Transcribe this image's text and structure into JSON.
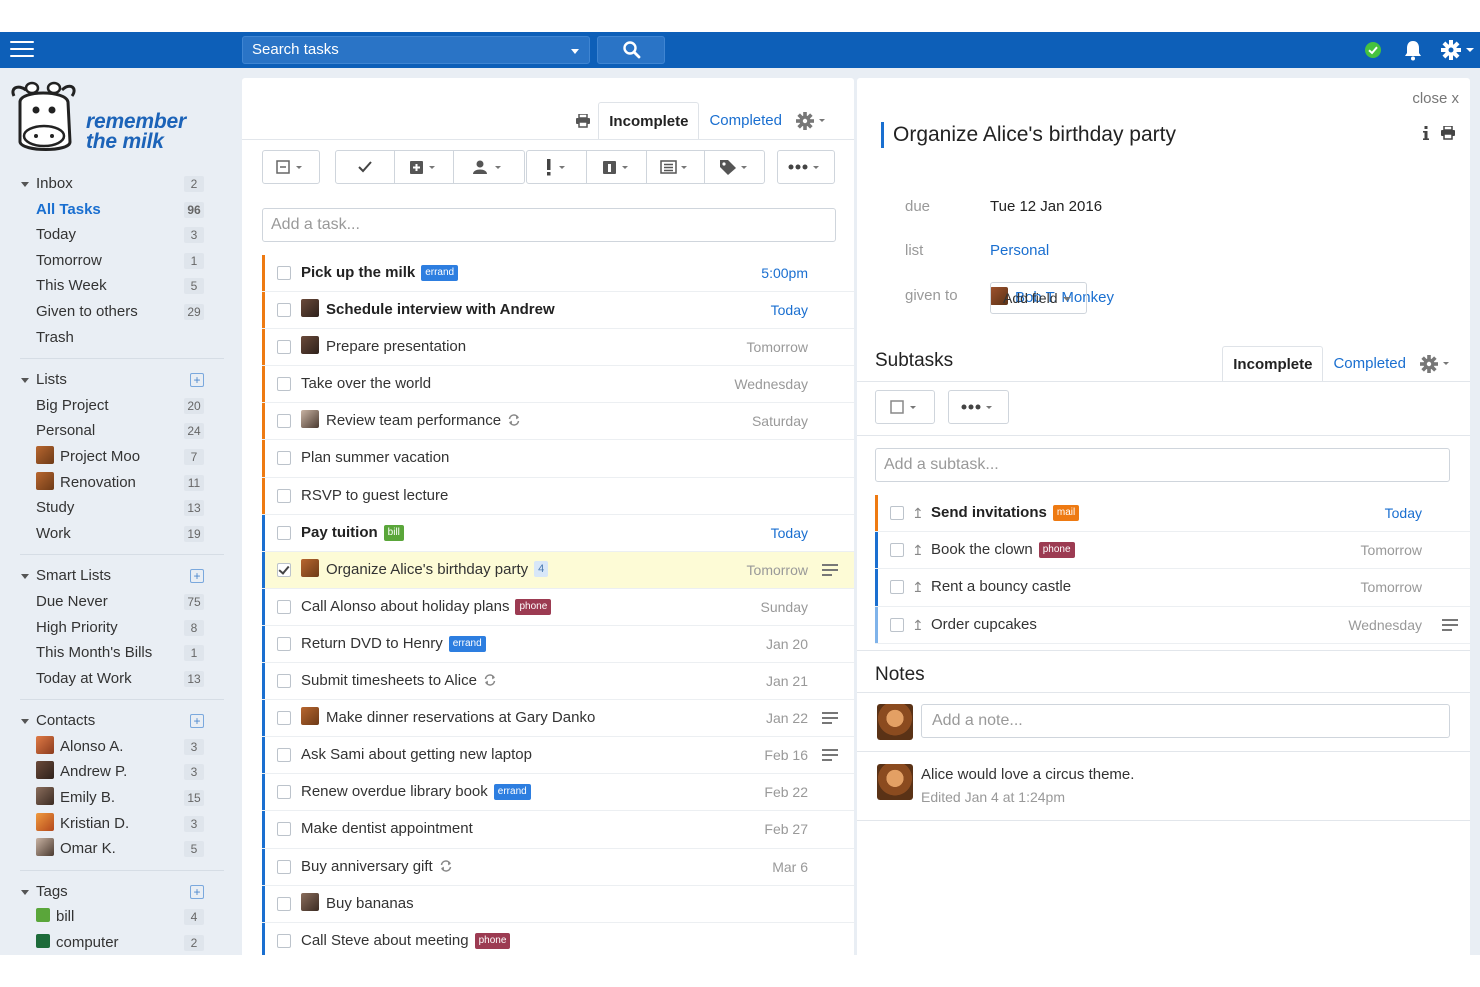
{
  "topbar": {
    "search_placeholder": "Search tasks",
    "accent": "#0d5fb8"
  },
  "logo": {
    "line1": "remember",
    "line2": "the milk"
  },
  "sidebar": {
    "groups": [
      {
        "label": "Inbox",
        "count": "2",
        "items": [
          {
            "label": "All Tasks",
            "count": "96",
            "active": true
          },
          {
            "label": "Today",
            "count": "3"
          },
          {
            "label": "Tomorrow",
            "count": "1"
          },
          {
            "label": "This Week",
            "count": "5"
          },
          {
            "label": "Given to others",
            "count": "29"
          },
          {
            "label": "Trash",
            "count": ""
          }
        ]
      },
      {
        "label": "Lists",
        "items": [
          {
            "label": "Big Project",
            "count": "20"
          },
          {
            "label": "Personal",
            "count": "24"
          },
          {
            "label": "Project Moo",
            "count": "7",
            "avatar": "moo"
          },
          {
            "label": "Renovation",
            "count": "11",
            "avatar": "moo"
          },
          {
            "label": "Study",
            "count": "13"
          },
          {
            "label": "Work",
            "count": "19"
          }
        ]
      },
      {
        "label": "Smart Lists",
        "items": [
          {
            "label": "Due Never",
            "count": "75"
          },
          {
            "label": "High Priority",
            "count": "8"
          },
          {
            "label": "This Month's Bills",
            "count": "1"
          },
          {
            "label": "Today at Work",
            "count": "13"
          }
        ]
      },
      {
        "label": "Contacts",
        "items": [
          {
            "label": "Alonso A.",
            "count": "3",
            "avatar": "alonso"
          },
          {
            "label": "Andrew P.",
            "count": "3",
            "avatar": "andrew"
          },
          {
            "label": "Emily B.",
            "count": "15",
            "avatar": "emily"
          },
          {
            "label": "Kristian D.",
            "count": "3",
            "avatar": "kristian"
          },
          {
            "label": "Omar K.",
            "count": "5",
            "avatar": "omar"
          }
        ]
      },
      {
        "label": "Tags",
        "items": [
          {
            "label": "bill",
            "count": "4",
            "tag": "#5aa63a"
          },
          {
            "label": "computer",
            "count": "2",
            "tag": "#1d6b3a"
          }
        ]
      }
    ]
  },
  "list": {
    "tabs": {
      "incomplete": "Incomplete",
      "completed": "Completed"
    },
    "add_task_placeholder": "Add a task...",
    "tasks": [
      {
        "name": "Pick up the milk",
        "tag": "errand",
        "due": "5:00pm",
        "due_blue": true,
        "bold": true,
        "bar": "#ee7a12"
      },
      {
        "name": "Schedule interview with Andrew",
        "avatar": "andrew",
        "due": "Today",
        "due_blue": true,
        "bold": true,
        "bar": "#ee7a12"
      },
      {
        "name": "Prepare presentation",
        "avatar": "andrew",
        "due": "Tomorrow",
        "bar": "#ee7a12"
      },
      {
        "name": "Take over the world",
        "due": "Wednesday",
        "bar": "#ee7a12"
      },
      {
        "name": "Review team performance",
        "avatar": "omar",
        "repeat": true,
        "due": "Saturday",
        "bar": "#ee7a12"
      },
      {
        "name": "Plan summer vacation",
        "due": "",
        "bar": "#ee7a12"
      },
      {
        "name": "RSVP to guest lecture",
        "due": "",
        "bar": "#ee7a12"
      },
      {
        "name": "Pay tuition",
        "tag": "bill",
        "due": "Today",
        "due_blue": true,
        "bold": true,
        "bar": "#1a6fd0"
      },
      {
        "name": "Organize Alice's birthday party",
        "avatar": "moo",
        "count": "4",
        "due": "Tomorrow",
        "checked": true,
        "selected": true,
        "note": true,
        "bar": "#1a6fd0"
      },
      {
        "name": "Call Alonso about holiday plans",
        "tag": "phone",
        "due": "Sunday",
        "bar": "#1a6fd0"
      },
      {
        "name": "Return DVD to Henry",
        "tag": "errand",
        "due": "Jan 20",
        "bar": "#1a6fd0"
      },
      {
        "name": "Submit timesheets to Alice",
        "repeat": true,
        "due": "Jan 21",
        "bar": "#1a6fd0"
      },
      {
        "name": "Make dinner reservations at Gary Danko",
        "avatar": "moo",
        "due": "Jan 22",
        "note": true,
        "bar": "#1a6fd0"
      },
      {
        "name": "Ask Sami about getting new laptop",
        "due": "Feb 16",
        "note": true,
        "bar": "#1a6fd0"
      },
      {
        "name": "Renew overdue library book",
        "tag": "errand",
        "due": "Feb 22",
        "bar": "#1a6fd0"
      },
      {
        "name": "Make dentist appointment",
        "due": "Feb 27",
        "bar": "#1a6fd0"
      },
      {
        "name": "Buy anniversary gift",
        "repeat": true,
        "due": "Mar 6",
        "bar": "#1a6fd0"
      },
      {
        "name": "Buy bananas",
        "avatar": "emily",
        "due": "",
        "bar": "#1a6fd0"
      },
      {
        "name": "Call Steve about meeting",
        "tag": "phone",
        "due": "",
        "bar": "#1a6fd0"
      }
    ]
  },
  "details": {
    "close": "close x",
    "title": "Organize Alice's birthday party",
    "due_label": "due",
    "due_value": "Tue 12 Jan 2016",
    "list_label": "list",
    "list_value": "Personal",
    "given_label": "given to",
    "given_value": "Bob T. Monkey",
    "add_field": "Add field",
    "subtasks_title": "Subtasks",
    "sub_tabs": {
      "incomplete": "Incomplete",
      "completed": "Completed"
    },
    "add_subtask_placeholder": "Add a subtask...",
    "subtasks": [
      {
        "name": "Send invitations",
        "tag": "mail",
        "due": "Today",
        "due_blue": true,
        "bold": true,
        "bar": "#ee7a12"
      },
      {
        "name": "Book the clown",
        "tag": "phone",
        "due": "Tomorrow",
        "bar": "#1a6fd0"
      },
      {
        "name": "Rent a bouncy castle",
        "due": "Tomorrow",
        "bar": "#1a6fd0"
      },
      {
        "name": "Order cupcakes",
        "due": "Wednesday",
        "note": true,
        "bar": "#7fb3ea"
      }
    ],
    "notes_title": "Notes",
    "add_note_placeholder": "Add a note...",
    "note_text": "Alice would love a circus theme.",
    "note_meta": "Edited Jan 4 at 1:24pm"
  }
}
